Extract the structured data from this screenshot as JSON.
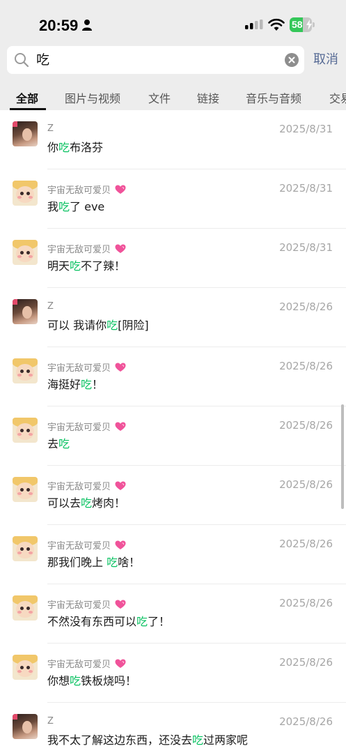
{
  "status_bar": {
    "time": "20:59",
    "battery_level": "58",
    "battery_fraction": 0.58
  },
  "search": {
    "query": "吃",
    "cancel_label": "取消"
  },
  "tabs": [
    {
      "label": "全部",
      "active": true
    },
    {
      "label": "图片与视频",
      "active": false
    },
    {
      "label": "文件",
      "active": false
    },
    {
      "label": "链接",
      "active": false
    },
    {
      "label": "音乐与音频",
      "active": false
    },
    {
      "label": "交易",
      "active": false
    }
  ],
  "results": [
    {
      "name": "Z",
      "avatar": "avatar-z",
      "heart": false,
      "date": "2025/8/31",
      "before": "你",
      "match": "吃",
      "after": "布洛芬"
    },
    {
      "name": "宇宙无敌可爱贝",
      "avatar": "avatar-baby",
      "heart": true,
      "date": "2025/8/31",
      "before": "我",
      "match": "吃",
      "after": "了 eve"
    },
    {
      "name": "宇宙无敌可爱贝",
      "avatar": "avatar-baby",
      "heart": true,
      "date": "2025/8/31",
      "before": "明天",
      "match": "吃",
      "after": "不了辣！"
    },
    {
      "name": "Z",
      "avatar": "avatar-z",
      "heart": false,
      "date": "2025/8/26",
      "before": "可以 我请你",
      "match": "吃",
      "after": "[阴险]"
    },
    {
      "name": "宇宙无敌可爱贝",
      "avatar": "avatar-baby",
      "heart": true,
      "date": "2025/8/26",
      "before": "海挺好",
      "match": "吃",
      "after": "！"
    },
    {
      "name": "宇宙无敌可爱贝",
      "avatar": "avatar-baby",
      "heart": true,
      "date": "2025/8/26",
      "before": "去",
      "match": "吃",
      "after": ""
    },
    {
      "name": "宇宙无敌可爱贝",
      "avatar": "avatar-baby",
      "heart": true,
      "date": "2025/8/26",
      "before": "可以去",
      "match": "吃",
      "after": "烤肉！"
    },
    {
      "name": "宇宙无敌可爱贝",
      "avatar": "avatar-baby",
      "heart": true,
      "date": "2025/8/26",
      "before": "那我们晚上 ",
      "match": "吃",
      "after": "啥！"
    },
    {
      "name": "宇宙无敌可爱贝",
      "avatar": "avatar-baby",
      "heart": true,
      "date": "2025/8/26",
      "before": "不然没有东西可以",
      "match": "吃",
      "after": "了！"
    },
    {
      "name": "宇宙无敌可爱贝",
      "avatar": "avatar-baby",
      "heart": true,
      "date": "2025/8/26",
      "before": "你想",
      "match": "吃",
      "after": "铁板烧吗！"
    },
    {
      "name": "Z",
      "avatar": "avatar-z",
      "heart": false,
      "date": "2025/8/26",
      "before": "我不太了解这边东西，还没去",
      "match": "吃",
      "after": "过两家呢"
    }
  ],
  "colors": {
    "highlight": "#07c160",
    "cancel": "#576b95",
    "battery_green": "#34c759",
    "heart": "#f0539a"
  }
}
